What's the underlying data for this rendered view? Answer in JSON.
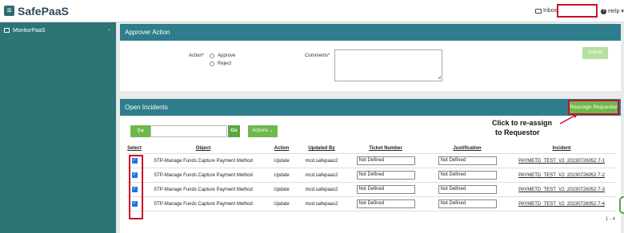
{
  "header": {
    "menu_icon": "hamburger-icon",
    "logo": "SafePaaS",
    "inbox_label": "Inbox",
    "help_label": "Help"
  },
  "sidebar": {
    "items": [
      {
        "label": "MonitorPaaS"
      }
    ]
  },
  "approver_panel": {
    "title": "Approver Action",
    "action_label": "Action*",
    "options": [
      "Approve",
      "Reject"
    ],
    "comments_label": "Comments*",
    "comments_value": "",
    "submit_label": "Submit"
  },
  "incidents_panel": {
    "title": "Open Incidents",
    "reassign_label": "Reassign Requestor",
    "search_placeholder": "",
    "go_label": "Go",
    "actions_label": "Actions",
    "columns": [
      "Select",
      "Object",
      "Action",
      "Updated By",
      "Ticket Number",
      "Justification",
      "Incident"
    ],
    "rows": [
      {
        "object": "STP-Manage Funds Capture Payment Method",
        "action": "Update",
        "updated_by": "mcd.safepaas2",
        "ticket": "Not Defined",
        "justification": "Not Defined",
        "incident": "PAYMETD_TEST_V2_20230726052 7-1"
      },
      {
        "object": "STP-Manage Funds Capture Payment Method",
        "action": "Update",
        "updated_by": "mcd.safepaas2",
        "ticket": "Not Defined",
        "justification": "Not Defined",
        "incident": "PAYMETD_TEST_V2_20230726052 7-2"
      },
      {
        "object": "STP-Manage Funds Capture Payment Method",
        "action": "Update",
        "updated_by": "mcd.safepaas2",
        "ticket": "Not Defined",
        "justification": "Not Defined",
        "incident": "PAYMETD_TEST_V2_20230726052 7-3"
      },
      {
        "object": "STP-Manage Funds Capture Payment Method",
        "action": "Update",
        "updated_by": "mcd.safepaas2",
        "ticket": "Not Defined",
        "justification": "Not Defined",
        "incident": "PAYMETD_TEST_V2_20230726052 7-4"
      }
    ],
    "pager": "1 - 4"
  },
  "callout": {
    "line1": "Click to re-assign",
    "line2": "to Requestor"
  },
  "colors": {
    "sidebar": "#2d7575",
    "panel_header": "#2e7d8c",
    "green": "#6fb94b",
    "highlight": "#c8102e"
  }
}
